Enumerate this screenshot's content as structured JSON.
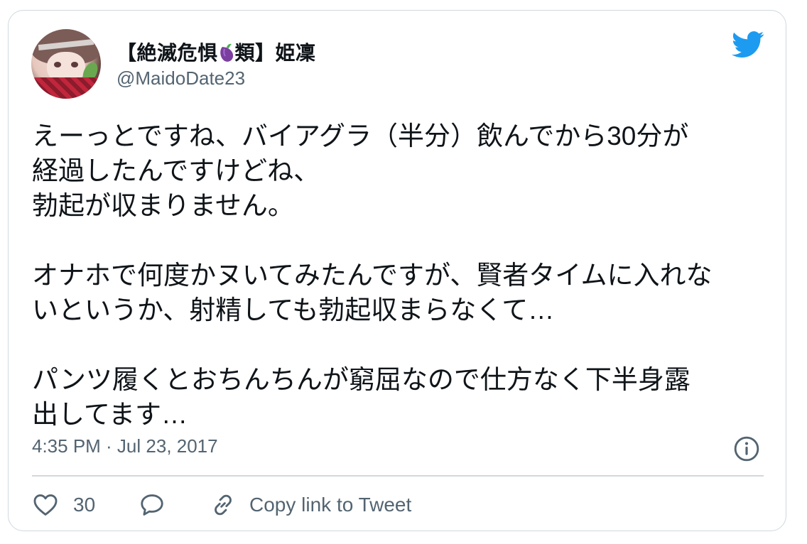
{
  "tweet": {
    "author": {
      "display_name_prefix": "【絶滅危惧",
      "display_name_suffix": "類】姫凜",
      "handle": "@MaidoDate23"
    },
    "body": "えーっとですね、バイアグラ（半分）飲んでから30分が\n経過したんですけどね、\n勃起が収まりません。\n\nオナホで何度かヌいてみたんですが、賢者タイムに入れな\nいというか、射精しても勃起収まらなくて…\n\nパンツ履くとおちんちんが窮屈なので仕方なく下半身露\n出してます…",
    "timestamp": "4:35 PM · Jul 23, 2017",
    "actions": {
      "like_count": "30",
      "copy_link_label": "Copy link to Tweet"
    }
  },
  "icons": {
    "brand": "twitter-bird-icon",
    "info": "info-icon",
    "like": "heart-icon",
    "reply": "speech-bubble-icon",
    "copy_link": "link-icon",
    "name_emoji": "eggplant-icon"
  },
  "colors": {
    "brand": "#1d9bf0",
    "secondary_text": "#536471",
    "border": "#cfd9de",
    "text": "#0f1419"
  }
}
